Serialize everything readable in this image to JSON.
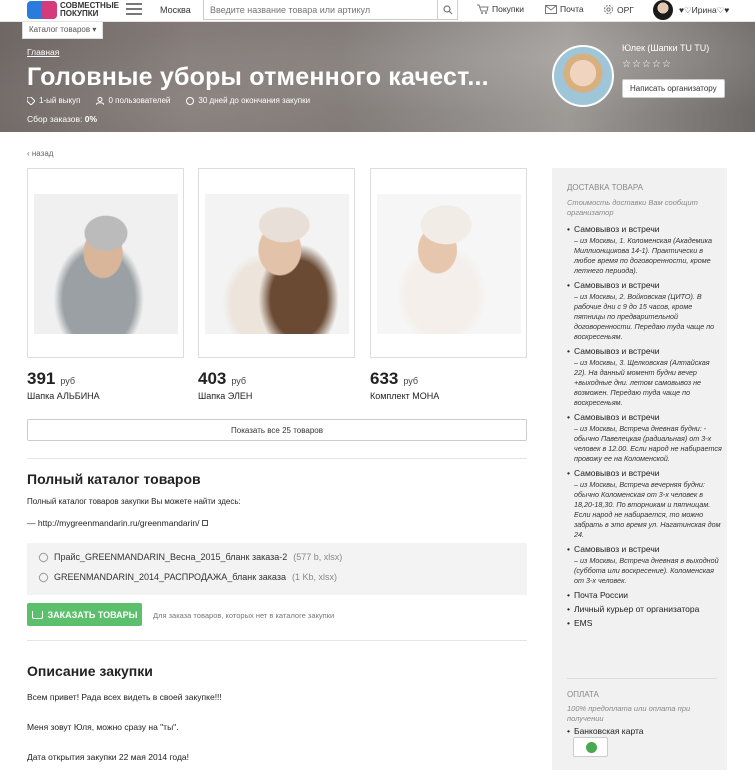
{
  "header": {
    "logo_text": "СОВМЕСТНЫЕ ПОКУПКИ",
    "city": "Москва",
    "search_placeholder": "Введите название товара или артикул",
    "nav": [
      {
        "label": "Покупки",
        "icon": "cart-icon"
      },
      {
        "label": "Почта",
        "icon": "mail-icon"
      },
      {
        "label": "ОРГ",
        "icon": "gear-icon"
      }
    ],
    "user": "♥♡Ирина♡♥"
  },
  "hero": {
    "catalog_label": "Каталог товаров",
    "breadcrumb": "Главная",
    "title": "Головные уборы отменного качест...",
    "meta": [
      "1-ый выкуп",
      "0 пользователей",
      "30 дней до окончания закупки"
    ],
    "collect_label": "Сбор заказов:",
    "collect_value": "0%",
    "organizer": "Юлек (Шапки TU TU)",
    "stars": "☆☆☆☆☆",
    "write_button": "Написать организатору"
  },
  "back": "‹ назад",
  "products": [
    {
      "price": "391",
      "currency": "руб",
      "name": "Шапка АЛЬБИНА"
    },
    {
      "price": "403",
      "currency": "руб",
      "name": "Шапка ЭЛЕН"
    },
    {
      "price": "633",
      "currency": "руб",
      "name": "Комплект МОНА"
    }
  ],
  "show_all": "Показать все 25 товаров",
  "catalog": {
    "title": "Полный каталог товаров",
    "text": "Полный каталог товаров закупки Вы можете найти здесь:",
    "link": "— http://mygreenmandarin.ru/greenmandarin/"
  },
  "files": [
    {
      "name": "Прайс_GREENMANDARIN_Весна_2015_бланк заказа-2",
      "meta": "(577 b, xlsx)"
    },
    {
      "name": "GREENMANDARIN_2014_РАСПРОДАЖА_бланк заказа",
      "meta": "(1 Kb, xlsx)"
    }
  ],
  "order": {
    "button": "ЗАКАЗАТЬ ТОВАРЫ",
    "note": "Для заказа товаров, которых нет в каталоге закупки"
  },
  "description": {
    "title": "Описание закупки",
    "lines": [
      "Всем привет! Рада всех видеть в своей закупке!!!",
      "Меня зовут Юля, можно сразу на \"ты\".",
      "Дата открытия закупки 22 мая 2014 года!"
    ]
  },
  "sidebar": {
    "delivery_title": "ДОСТАВКА ТОВАРА",
    "delivery_sub": "Стоимость доставки Вам сообщит организатор",
    "delivery": [
      {
        "label": "Самовывоз и встречи",
        "detail": "– из Москвы, 1. Коломенская (Академика Миллионщикова 14-1). Практически в любое время по договоренности, кроме летнего периода)."
      },
      {
        "label": "Самовывоз и встречи",
        "detail": "– из Москвы, 2. Войковская (ЦИТО). В рабочие дни с 9 до 15 часов, кроме пятницы по предварительной договоренности. Передаю туда чаще по воскресеньям."
      },
      {
        "label": "Самовывоз и встречи",
        "detail": "– из Москвы, 3. Щелковская (Алтайская 22). На данный момент будни вечер +выходные дни. летом самовывоз не возможен. Передаю туда чаще по воскресеньям."
      },
      {
        "label": "Самовывоз и встречи",
        "detail": "– из Москвы, Встреча дневная будни: - обычно Павелецкая (радиальная) от 3-х человек в 12.00. Если народ не набирается провожу ее на Коломенской."
      },
      {
        "label": "Самовывоз и встречи",
        "detail": "– из Москвы, Встреча вечерняя будни: обычно Коломенская от 3-х человек в 18,20-18,30. По вторникам и пятницам. Если народ не набирается, то можно забрать в это время ул. Нагатинская дом 24."
      },
      {
        "label": "Самовывоз и встречи",
        "detail": "– из Москвы, Встреча дневная в выходной (суббота или воскресение). Коломенская от 3-х человек."
      },
      {
        "label": "Почта России",
        "detail": ""
      },
      {
        "label": "Личный курьер от организатора",
        "detail": ""
      },
      {
        "label": "EMS",
        "detail": ""
      }
    ],
    "payment_title": "ОПЛАТА",
    "payment_sub": "100% предоплата или оплата при получении",
    "payment": [
      "Банковская карта"
    ]
  }
}
